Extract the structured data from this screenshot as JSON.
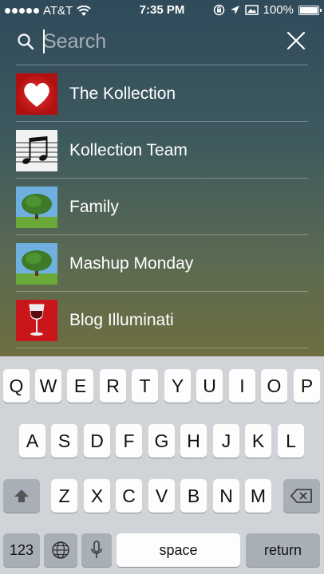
{
  "status_bar": {
    "carrier": "AT&T",
    "time": "7:35 PM",
    "battery": "100%"
  },
  "search": {
    "placeholder": "Search",
    "value": ""
  },
  "results": [
    {
      "label": "The Kollection",
      "icon": "heart-icon"
    },
    {
      "label": "Kollection Team",
      "icon": "music-notes-icon"
    },
    {
      "label": "Family",
      "icon": "tree-icon"
    },
    {
      "label": "Mashup Monday",
      "icon": "tree-icon"
    },
    {
      "label": "Blog Illuminati",
      "icon": "wine-glass-icon"
    }
  ],
  "keyboard": {
    "row1": [
      "Q",
      "W",
      "E",
      "R",
      "T",
      "Y",
      "U",
      "I",
      "O",
      "P"
    ],
    "row2": [
      "A",
      "S",
      "D",
      "F",
      "G",
      "H",
      "J",
      "K",
      "L"
    ],
    "row3": [
      "Z",
      "X",
      "C",
      "V",
      "B",
      "N",
      "M"
    ],
    "numbers_label": "123",
    "space_label": "space",
    "return_label": "return"
  },
  "colors": {
    "heart_bg": "#d31c1c",
    "wine_bg": "#c8161a"
  }
}
